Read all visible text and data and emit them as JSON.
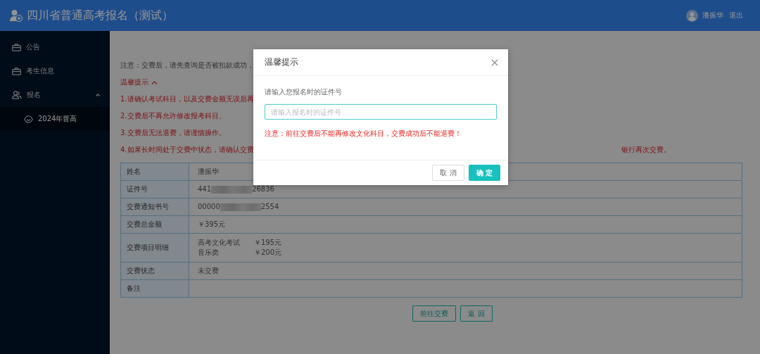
{
  "header": {
    "title": "四川省普通高考报名（测试）",
    "user": "潘振华",
    "logout": "退出"
  },
  "sidebar": {
    "items": [
      {
        "label": "公告",
        "kind": "link"
      },
      {
        "label": "考生信息",
        "kind": "link"
      },
      {
        "label": "报名",
        "kind": "group",
        "expanded": true,
        "children": [
          {
            "label": "2024年普高",
            "selected": true
          }
        ]
      }
    ]
  },
  "page": {
    "notice": "注意：交费后，请先查询是否被扣款成功，",
    "tips_toggle": {
      "label": "温馨提示",
      "expanded": true
    },
    "tips": [
      {
        "text": "1.请确认考试科目，以及交费金额无误后再"
      },
      {
        "text": "2.交费后不再允许修改报考科目。"
      },
      {
        "text": "3.交费后无法退费，请谨慎操作。"
      },
      {
        "text": "4.如果长时间处于交费中状态，请确认交费",
        "tail": "银行再次交费。"
      }
    ],
    "table": {
      "rows": [
        {
          "kind": "text",
          "label": "姓名",
          "value": "潘振华"
        },
        {
          "kind": "masked",
          "label": "证件号",
          "start": "441",
          "end": "26836"
        },
        {
          "kind": "masked",
          "label": "交费通知书号",
          "start": "00000",
          "end": "2554"
        },
        {
          "kind": "text",
          "label": "交费总金额",
          "value": "￥395元"
        },
        {
          "kind": "items",
          "label": "交费项目明细",
          "items": [
            {
              "name": "高考文化考试",
              "amount": "￥195元"
            },
            {
              "name": "音乐类",
              "amount": "￥200元"
            }
          ]
        },
        {
          "kind": "text",
          "label": "交费状态",
          "value": "未交费"
        },
        {
          "kind": "text",
          "label": "备注"
        }
      ]
    },
    "buttons": [
      "前往交费",
      "返 回"
    ]
  },
  "dialog": {
    "title": "温馨提示",
    "label": "请输入您报名时的证件号",
    "placeholder": "请输入报名时的证件号",
    "warning": "注意：前往交费后不能再修改文化科目，交费成功后不能退费！",
    "buttons": [
      {
        "label": "取 消",
        "kind": "default"
      },
      {
        "label": "确 定",
        "kind": "primary"
      }
    ]
  }
}
